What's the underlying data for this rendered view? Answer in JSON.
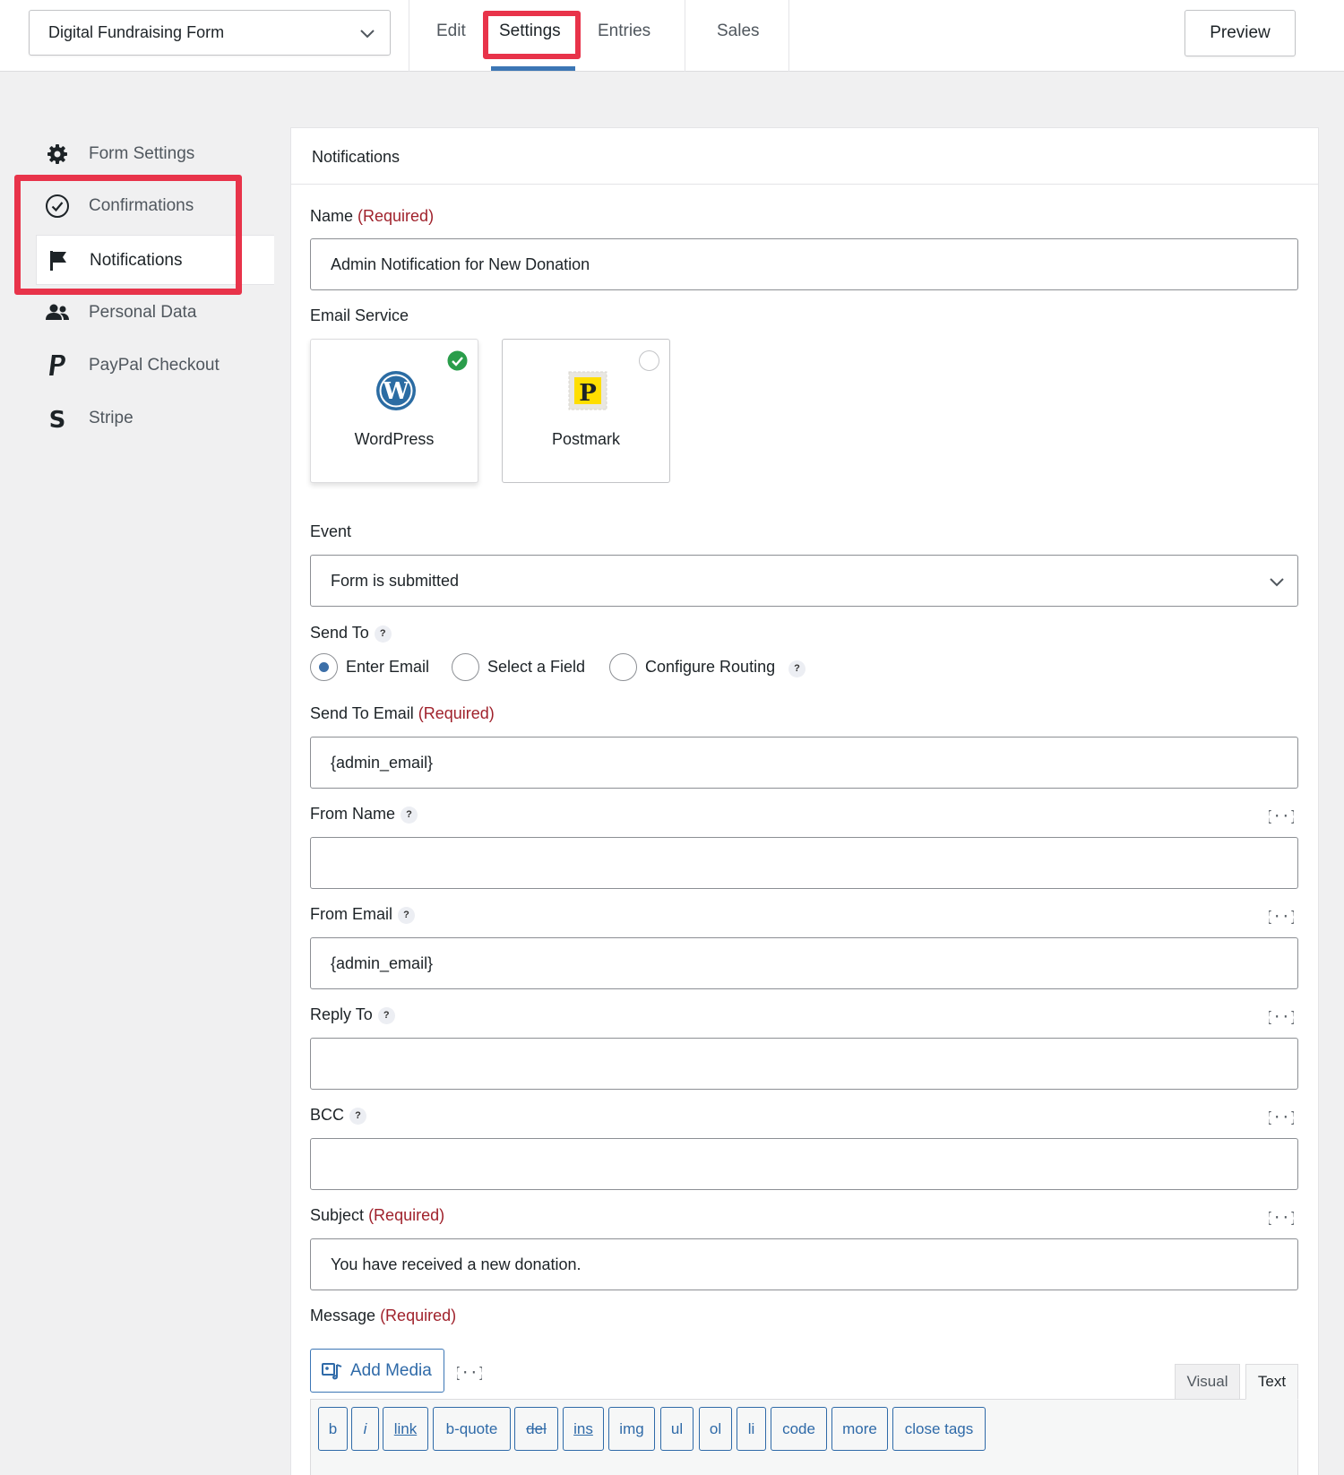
{
  "header": {
    "form_selector": "Digital Fundraising Form",
    "tabs": [
      {
        "label": "Edit"
      },
      {
        "label": "Settings"
      },
      {
        "label": "Entries"
      },
      {
        "label": "Sales"
      }
    ],
    "active_tab": "Settings",
    "preview_label": "Preview"
  },
  "sidebar": {
    "items": [
      {
        "label": "Form Settings",
        "icon": "gear-icon"
      },
      {
        "label": "Confirmations",
        "icon": "check-circle-icon"
      },
      {
        "label": "Notifications",
        "icon": "flag-icon"
      },
      {
        "label": "Personal Data",
        "icon": "users-icon"
      },
      {
        "label": "PayPal Checkout",
        "icon": "paypal-icon"
      },
      {
        "label": "Stripe",
        "icon": "stripe-icon"
      }
    ],
    "active": "Notifications"
  },
  "panel": {
    "title": "Notifications",
    "name": {
      "label": "Name",
      "required": "(Required)",
      "value": "Admin Notification for New Donation"
    },
    "email_service": {
      "label": "Email Service",
      "options": [
        {
          "label": "WordPress",
          "selected": true
        },
        {
          "label": "Postmark",
          "selected": false
        }
      ]
    },
    "event": {
      "label": "Event",
      "value": "Form is submitted"
    },
    "send_to": {
      "label": "Send To",
      "help": "?",
      "options": [
        "Enter Email",
        "Select a Field",
        "Configure Routing"
      ],
      "selected": "Enter Email"
    },
    "send_to_email": {
      "label": "Send To Email",
      "required": "(Required)",
      "value": "{admin_email}"
    },
    "from_name": {
      "label": "From Name",
      "value": ""
    },
    "from_email": {
      "label": "From Email",
      "value": "{admin_email}"
    },
    "reply_to": {
      "label": "Reply To",
      "value": ""
    },
    "bcc": {
      "label": "BCC",
      "value": ""
    },
    "subject": {
      "label": "Subject",
      "required": "(Required)",
      "value": "You have received a new donation."
    },
    "message": {
      "label": "Message",
      "required": "(Required)",
      "add_media": "Add Media",
      "editor_tabs": [
        "Visual",
        "Text"
      ],
      "active_editor_tab": "Text",
      "quicktags": [
        "b",
        "i",
        "link",
        "b-quote",
        "del",
        "ins",
        "img",
        "ul",
        "ol",
        "li",
        "code",
        "more",
        "close tags"
      ]
    }
  },
  "colors": {
    "highlight": "#e8334a",
    "accent": "#3c76b5",
    "required": "#a0222c",
    "selected_check": "#2a9d4b"
  }
}
